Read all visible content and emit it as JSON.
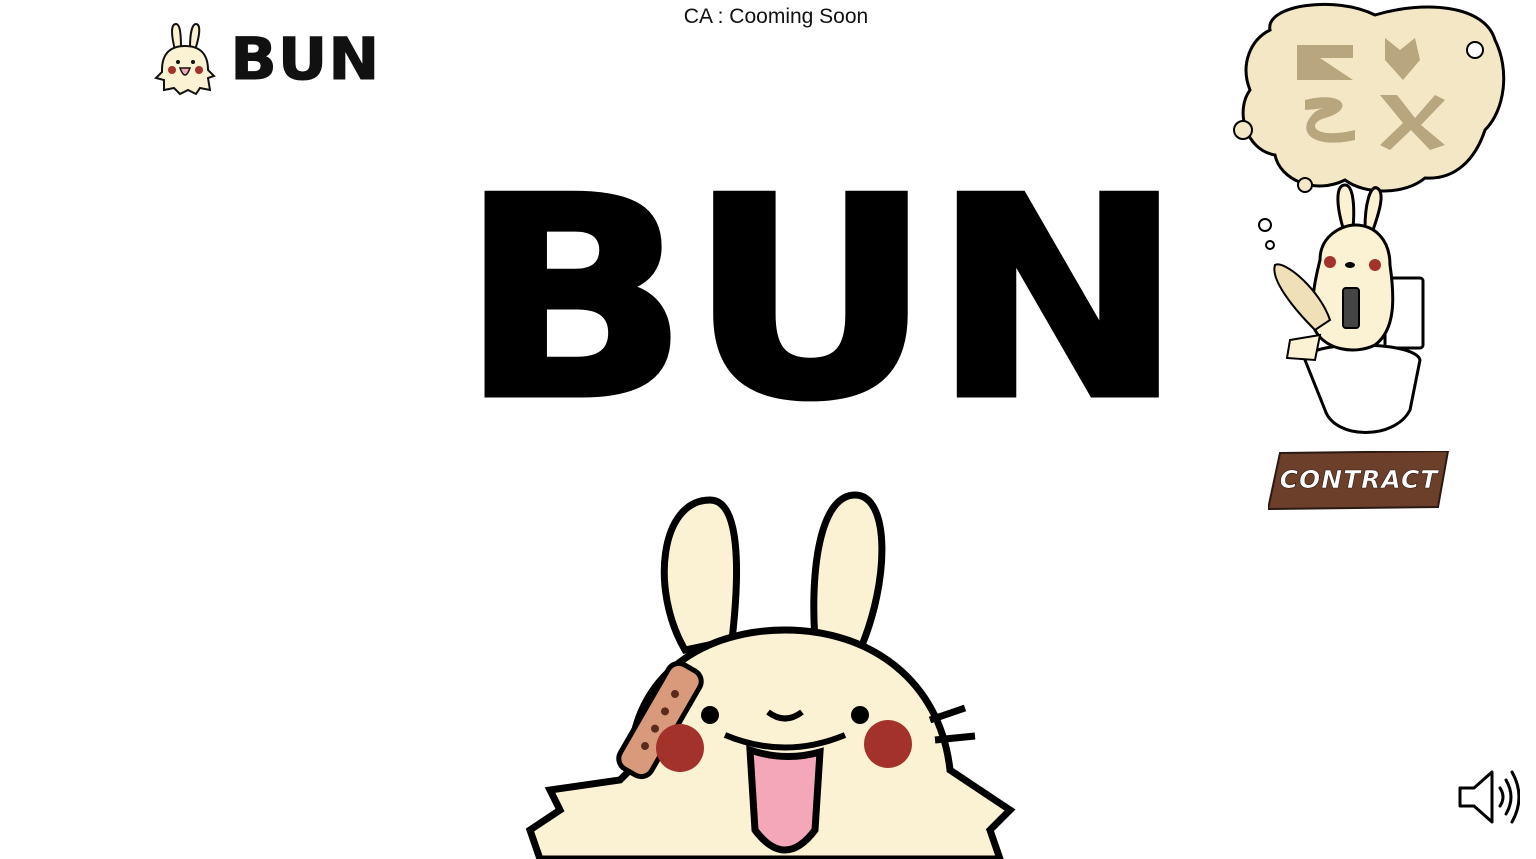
{
  "header": {
    "ca_text": "CA : Cooming Soon"
  },
  "logo": {
    "text": "BUN",
    "mascot_icon": "bunny-mascot-icon"
  },
  "hero": {
    "title": "BUN",
    "mascot_icon": "bunny-face-icon"
  },
  "side_panel": {
    "art_icon": "bunny-on-toilet-icon",
    "cloud_icons": [
      "arrow-logo-icon",
      "bird-logo-icon",
      "swirl-logo-icon",
      "x-logo-icon"
    ],
    "contract_label": "CONTRACT"
  },
  "controls": {
    "sound_icon": "speaker-volume-icon"
  },
  "colors": {
    "bunny_fill": "#fbf1d3",
    "cheek": "#a3332a",
    "mouth": "#f4a7b9",
    "contract_bg": "#6b3f2a",
    "cloud_fill": "#f3e7c5",
    "logo_tint": "#b7a67e"
  }
}
